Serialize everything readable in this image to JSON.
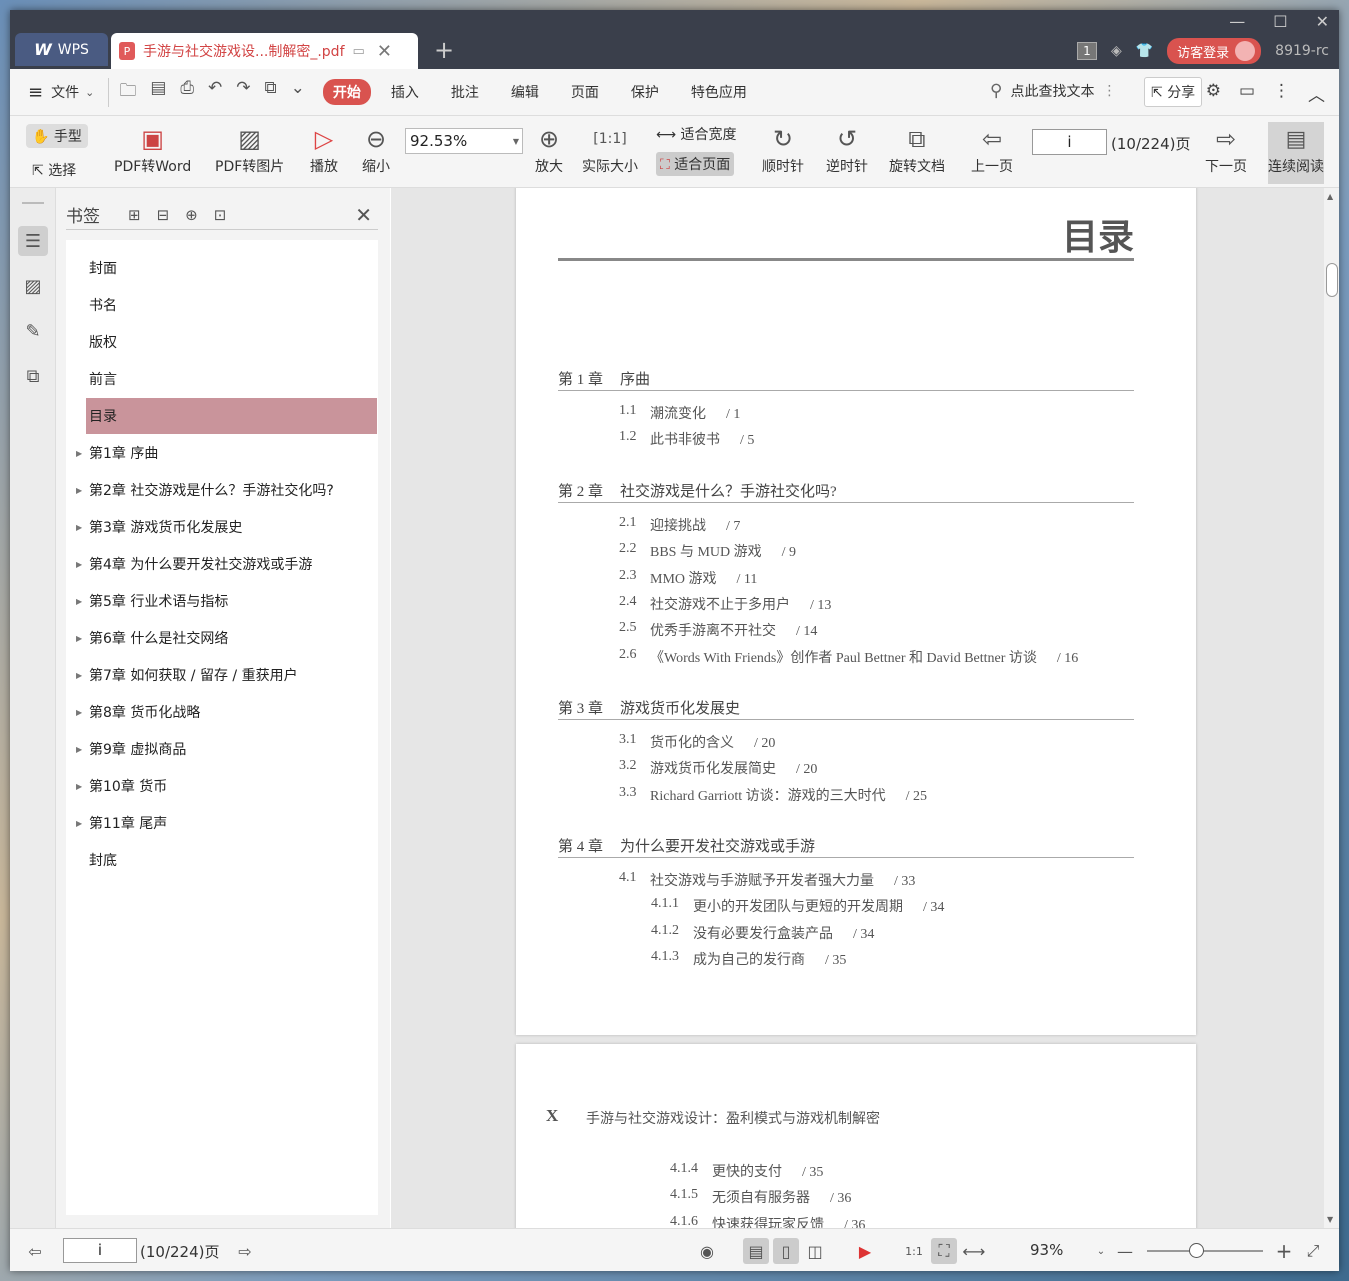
{
  "titlebar": {
    "app_tab": "WPS",
    "doc_tab": "手游与社交游戏设...制解密_.pdf",
    "window_count": "1",
    "login_label": "访客登录",
    "user_code": "8919-rc"
  },
  "menu": {
    "file": "文件",
    "start": "开始",
    "items": [
      "插入",
      "批注",
      "编辑",
      "页面",
      "保护",
      "特色应用"
    ],
    "search_label": "点此查找文本",
    "share": "分享"
  },
  "toolbar": {
    "hand": "手型",
    "select": "选择",
    "pdf_to_word": "PDF转Word",
    "pdf_to_image": "PDF转图片",
    "play": "播放",
    "zoom_out": "缩小",
    "zoom_value": "92.53%",
    "zoom_in": "放大",
    "actual_size": "实际大小",
    "fit_width": "适合宽度",
    "fit_page": "适合页面",
    "rotate_cw": "顺时针",
    "rotate_ccw": "逆时针",
    "rotate_doc": "旋转文档",
    "prev_page": "上一页",
    "page_value": "i",
    "page_count": "(10/224)页",
    "next_page": "下一页",
    "continuous": "连续阅读"
  },
  "bookmarks": {
    "title": "书签",
    "items": [
      {
        "label": "封面",
        "expandable": false,
        "selected": false
      },
      {
        "label": "书名",
        "expandable": false,
        "selected": false
      },
      {
        "label": "版权",
        "expandable": false,
        "selected": false
      },
      {
        "label": "前言",
        "expandable": false,
        "selected": false
      },
      {
        "label": "目录",
        "expandable": false,
        "selected": true
      },
      {
        "label": "第1章 序曲",
        "expandable": true,
        "selected": false
      },
      {
        "label": "第2章 社交游戏是什么？手游社交化吗?",
        "expandable": true,
        "selected": false
      },
      {
        "label": "第3章 游戏货币化发展史",
        "expandable": true,
        "selected": false
      },
      {
        "label": "第4章 为什么要开发社交游戏或手游",
        "expandable": true,
        "selected": false
      },
      {
        "label": "第5章 行业术语与指标",
        "expandable": true,
        "selected": false
      },
      {
        "label": "第6章 什么是社交网络",
        "expandable": true,
        "selected": false
      },
      {
        "label": "第7章 如何获取 / 留存 / 重获用户",
        "expandable": true,
        "selected": false
      },
      {
        "label": "第8章 货币化战略",
        "expandable": true,
        "selected": false
      },
      {
        "label": "第9章 虚拟商品",
        "expandable": true,
        "selected": false
      },
      {
        "label": "第10章 货币",
        "expandable": true,
        "selected": false
      },
      {
        "label": "第11章 尾声",
        "expandable": true,
        "selected": false
      },
      {
        "label": "封底",
        "expandable": false,
        "selected": false
      }
    ]
  },
  "page1": {
    "title": "目录",
    "chapters": [
      {
        "num": "第 1 章",
        "title": "序曲",
        "entries": [
          {
            "no": "1.1",
            "text": "潮流变化",
            "page": "/ 1",
            "level": 1
          },
          {
            "no": "1.2",
            "text": "此书非彼书",
            "page": "/ 5",
            "level": 1
          }
        ]
      },
      {
        "num": "第 2 章",
        "title": "社交游戏是什么？手游社交化吗?",
        "entries": [
          {
            "no": "2.1",
            "text": "迎接挑战",
            "page": "/ 7",
            "level": 1
          },
          {
            "no": "2.2",
            "text": "BBS 与 MUD 游戏",
            "page": "/ 9",
            "level": 1
          },
          {
            "no": "2.3",
            "text": "MMO 游戏",
            "page": "/ 11",
            "level": 1
          },
          {
            "no": "2.4",
            "text": "社交游戏不止于多用户",
            "page": "/ 13",
            "level": 1
          },
          {
            "no": "2.5",
            "text": "优秀手游离不开社交",
            "page": "/ 14",
            "level": 1
          },
          {
            "no": "2.6",
            "text": "《Words With Friends》创作者 Paul Bettner 和 David Bettner 访谈",
            "page": "/ 16",
            "level": 1
          }
        ]
      },
      {
        "num": "第 3 章",
        "title": "游戏货币化发展史",
        "entries": [
          {
            "no": "3.1",
            "text": "货币化的含义",
            "page": "/ 20",
            "level": 1
          },
          {
            "no": "3.2",
            "text": "游戏货币化发展简史",
            "page": "/ 20",
            "level": 1
          },
          {
            "no": "3.3",
            "text": "Richard Garriott 访谈：游戏的三大时代",
            "page": "/ 25",
            "level": 1
          }
        ]
      },
      {
        "num": "第 4 章",
        "title": "为什么要开发社交游戏或手游",
        "entries": [
          {
            "no": "4.1",
            "text": "社交游戏与手游赋予开发者强大力量",
            "page": "/ 33",
            "level": 1
          },
          {
            "no": "4.1.1",
            "text": "更小的开发团队与更短的开发周期",
            "page": "/ 34",
            "level": 2
          },
          {
            "no": "4.1.2",
            "text": "没有必要发行盒装产品",
            "page": "/ 34",
            "level": 2
          },
          {
            "no": "4.1.3",
            "text": "成为自己的发行商",
            "page": "/ 35",
            "level": 2
          }
        ]
      }
    ]
  },
  "page2": {
    "marker": "X",
    "header": "手游与社交游戏设计：盈利模式与游戏机制解密",
    "entries": [
      {
        "no": "4.1.4",
        "text": "更快的支付",
        "page": "/ 35"
      },
      {
        "no": "4.1.5",
        "text": "无须自有服务器",
        "page": "/ 36"
      },
      {
        "no": "4.1.6",
        "text": "快速获得玩家反馈",
        "page": "/ 36"
      }
    ]
  },
  "statusbar": {
    "page_value": "i",
    "page_count": "(10/224)页",
    "zoom": "93%",
    "zoom_fraction": 0.42
  }
}
